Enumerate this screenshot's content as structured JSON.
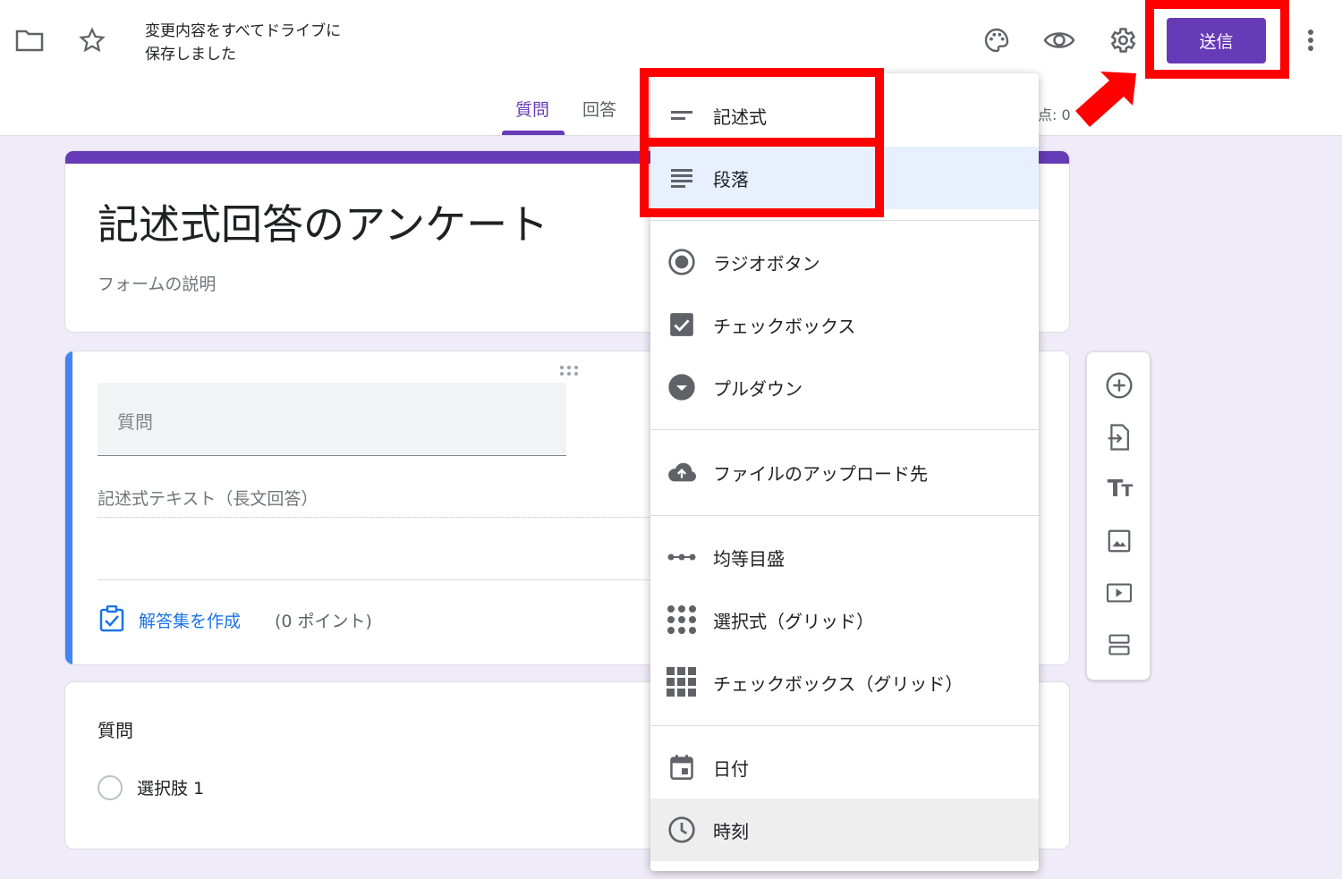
{
  "header": {
    "folder_icon": "folder-icon",
    "star_icon": "star-icon",
    "save_status_line1": "変更内容をすべてドライブに",
    "save_status_line2": "保存しました",
    "palette_icon": "palette-icon",
    "preview_icon": "eye-icon",
    "settings_icon": "gear-icon",
    "send_label": "送信",
    "more_icon": "more-vert-icon",
    "tabs": [
      {
        "label": "質問",
        "active": true
      },
      {
        "label": "回答",
        "active": false
      }
    ],
    "total_points": "点: 0"
  },
  "form": {
    "title": "記述式回答のアンケート",
    "description_placeholder": "フォームの説明",
    "question_card": {
      "question_placeholder": "質問",
      "answer_placeholder": "記述式テキスト（長文回答）",
      "answer_key_label": "解答集を作成",
      "points_label": "(0 ポイント)"
    },
    "second_card": {
      "question_title": "質問",
      "option_label": "選択肢 1"
    }
  },
  "type_menu": {
    "items": [
      {
        "label": "記述式",
        "icon": "short-text-icon"
      },
      {
        "label": "段落",
        "icon": "paragraph-icon"
      },
      {
        "label": "ラジオボタン",
        "icon": "radio-button-icon"
      },
      {
        "label": "チェックボックス",
        "icon": "checkbox-icon"
      },
      {
        "label": "プルダウン",
        "icon": "dropdown-icon"
      },
      {
        "label": "ファイルのアップロード先",
        "icon": "cloud-upload-icon"
      },
      {
        "label": "均等目盛",
        "icon": "linear-scale-icon"
      },
      {
        "label": "選択式（グリッド）",
        "icon": "multiple-choice-grid-icon"
      },
      {
        "label": "チェックボックス（グリッド）",
        "icon": "checkbox-grid-icon"
      },
      {
        "label": "日付",
        "icon": "calendar-icon"
      },
      {
        "label": "時刻",
        "icon": "clock-icon"
      }
    ],
    "highlighted": "段落"
  },
  "side_toolbar": [
    "add-question-icon",
    "import-questions-icon",
    "add-title-icon",
    "add-image-icon",
    "add-video-icon",
    "add-section-icon"
  ],
  "colors": {
    "accent": "#673ab7",
    "callout": "#ff0000",
    "background": "#f0ebf8",
    "question_accent": "#4285f4",
    "link": "#1a73e8"
  }
}
